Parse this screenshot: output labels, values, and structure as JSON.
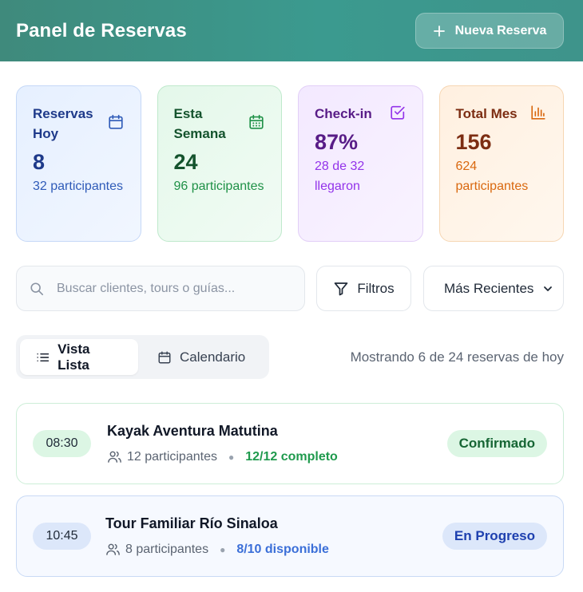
{
  "header": {
    "title": "Panel de Reservas",
    "new_button_label": "Nueva Reserva"
  },
  "stats": [
    {
      "label": "Reservas Hoy",
      "value": "8",
      "sub": "32 participantes",
      "icon": "calendar-icon",
      "color": "#1e3a8a"
    },
    {
      "label": "Esta Semana",
      "value": "24",
      "sub": "96 participantes",
      "icon": "calendar-days-icon",
      "color": "#14532d"
    },
    {
      "label": "Check-in",
      "value": "87%",
      "sub": "28 de 32 llegaron",
      "icon": "check-square-icon",
      "color": "#581c87"
    },
    {
      "label": "Total Mes",
      "value": "156",
      "sub": "624 participantes",
      "icon": "bar-chart-icon",
      "color": "#7c2d12"
    }
  ],
  "search": {
    "placeholder": "Buscar clientes, tours o guías...",
    "value": ""
  },
  "filters": {
    "filter_label": "Filtros",
    "sort_selected": "Más Recientes"
  },
  "view": {
    "list_label": "Vista Lista",
    "calendar_label": "Calendario",
    "active": "list"
  },
  "showing_text": "Mostrando 6 de 24 reservas de hoy",
  "reservations": [
    {
      "time": "08:30",
      "title": "Kayak Aventura Matutina",
      "participants": "12 participantes",
      "capacity": "12/12 completo",
      "status": "Confirmado"
    },
    {
      "time": "10:45",
      "title": "Tour Familiar Río Sinaloa",
      "participants": "8 participantes",
      "capacity": "8/10 disponible",
      "status": "En Progreso"
    }
  ],
  "colors": {
    "header_bg": "#3b9a8f",
    "confirmed": "#166534",
    "in_progress": "#1e40af"
  }
}
